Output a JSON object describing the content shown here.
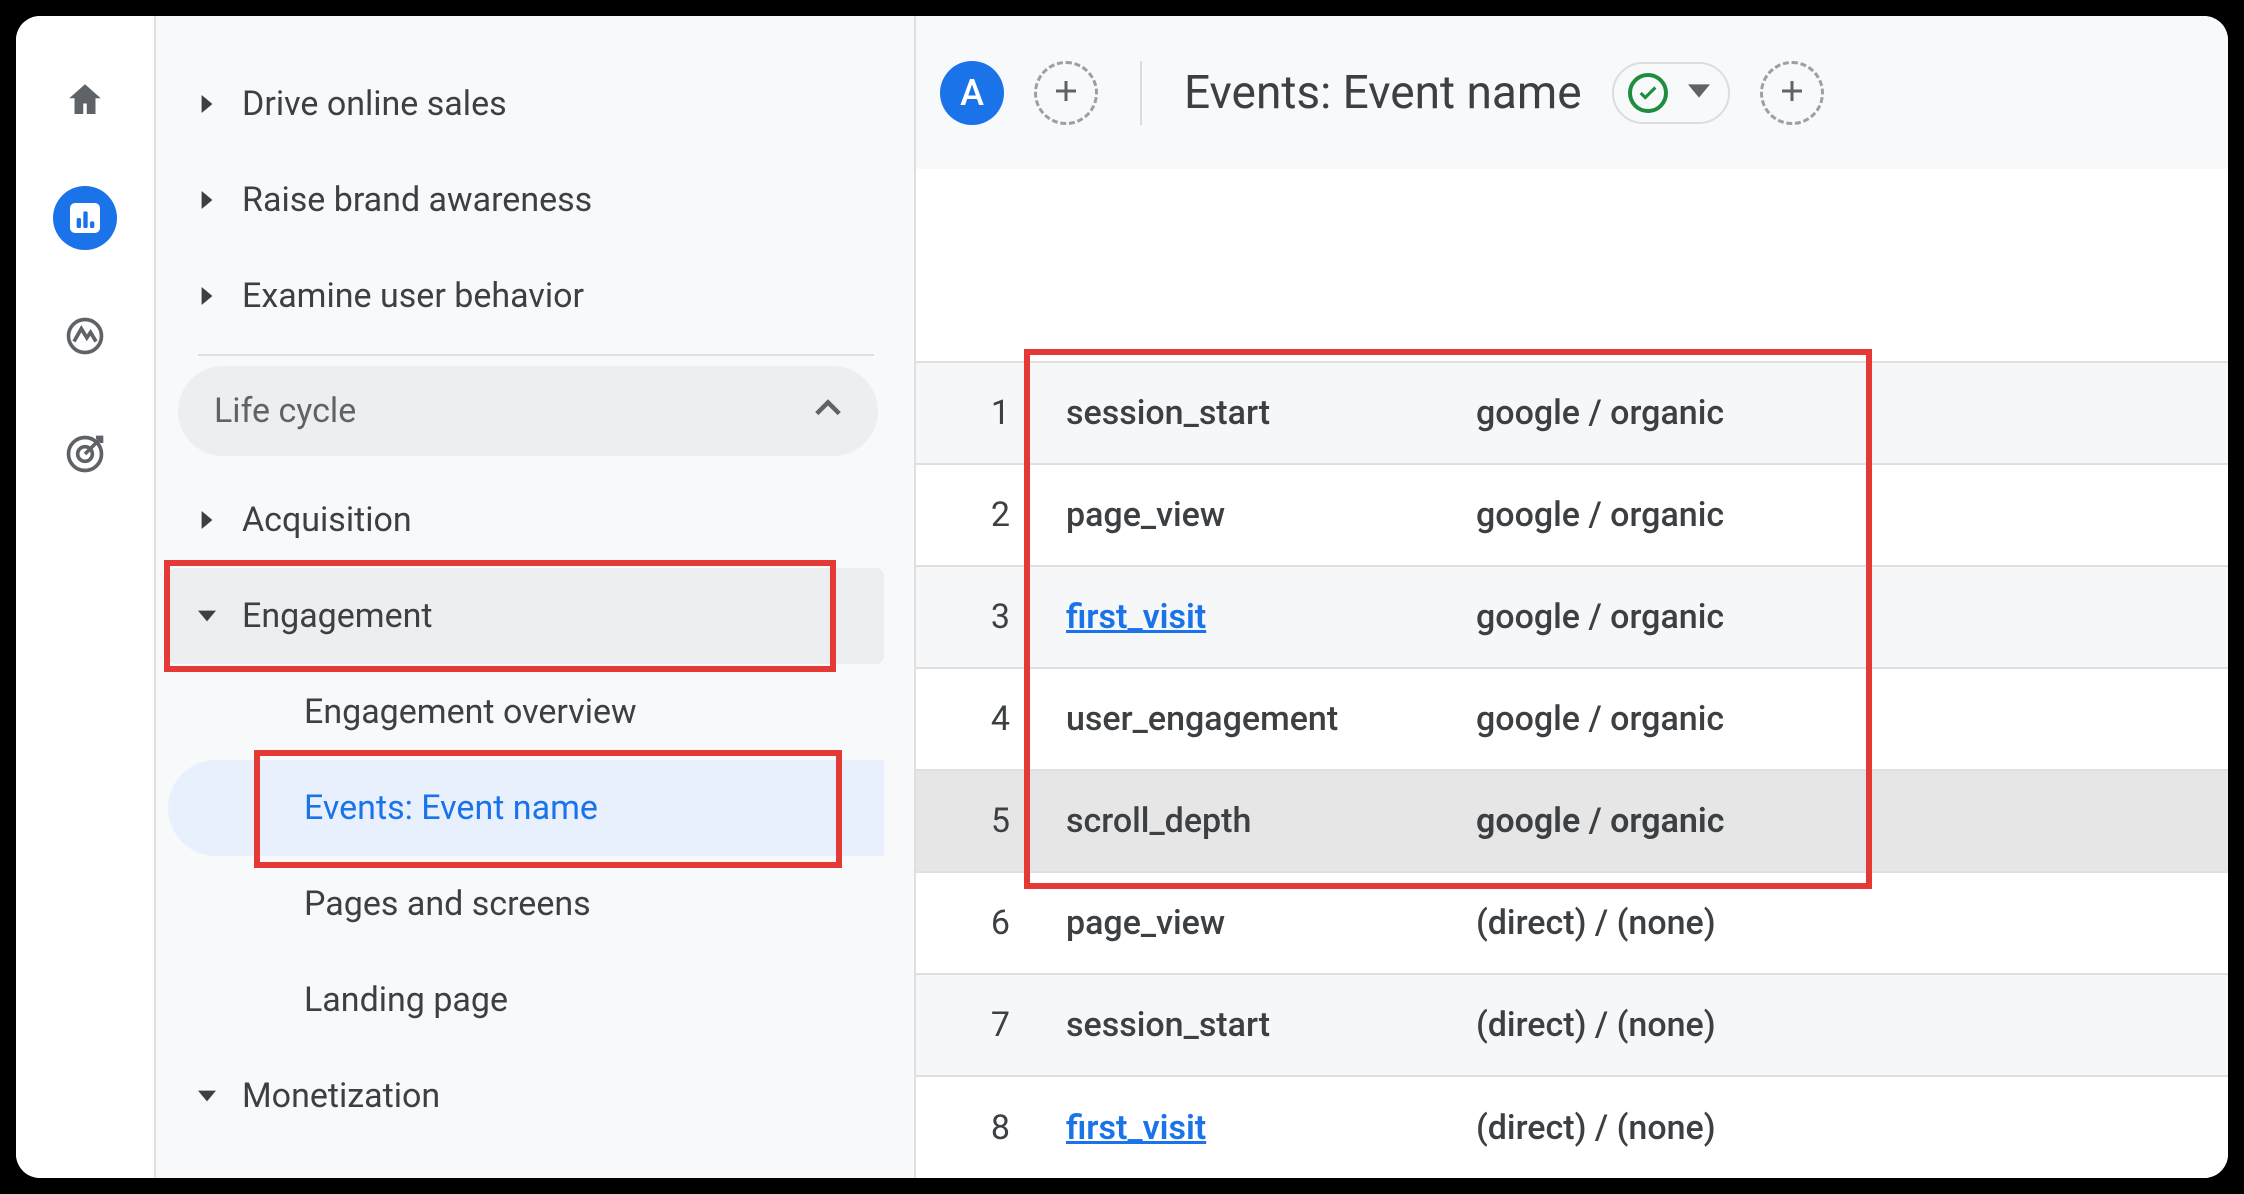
{
  "rail": {
    "home": "home-icon",
    "reports": "reports-icon",
    "explore": "explore-icon",
    "ads": "ads-icon"
  },
  "sidebar": {
    "top": [
      {
        "label": "Drive online sales"
      },
      {
        "label": "Raise brand awareness"
      },
      {
        "label": "Examine user behavior"
      }
    ],
    "section": "Life cycle",
    "items": [
      {
        "label": "Acquisition",
        "expanded": false
      },
      {
        "label": "Engagement",
        "expanded": true,
        "children": [
          {
            "label": "Engagement overview"
          },
          {
            "label": "Events: Event name",
            "active": true
          },
          {
            "label": "Pages and screens"
          },
          {
            "label": "Landing page"
          }
        ]
      },
      {
        "label": "Monetization",
        "expanded": true
      }
    ]
  },
  "toolbar": {
    "badge": "A",
    "title": "Events: Event name"
  },
  "table": {
    "rows": [
      {
        "n": "1",
        "event": "session_start",
        "source": "google / organic",
        "link": false,
        "alt": true
      },
      {
        "n": "2",
        "event": "page_view",
        "source": "google / organic",
        "link": false,
        "alt": false
      },
      {
        "n": "3",
        "event": "first_visit",
        "source": "google / organic",
        "link": true,
        "alt": true
      },
      {
        "n": "4",
        "event": "user_engagement",
        "source": "google / organic",
        "link": false,
        "alt": false
      },
      {
        "n": "5",
        "event": "scroll_depth",
        "source": "google / organic",
        "link": false,
        "alt": false,
        "hover": true
      },
      {
        "n": "6",
        "event": "page_view",
        "source": "(direct) / (none)",
        "link": false,
        "alt": false
      },
      {
        "n": "7",
        "event": "session_start",
        "source": "(direct) / (none)",
        "link": false,
        "alt": true
      },
      {
        "n": "8",
        "event": "first_visit",
        "source": "(direct) / (none)",
        "link": true,
        "alt": false
      }
    ]
  }
}
